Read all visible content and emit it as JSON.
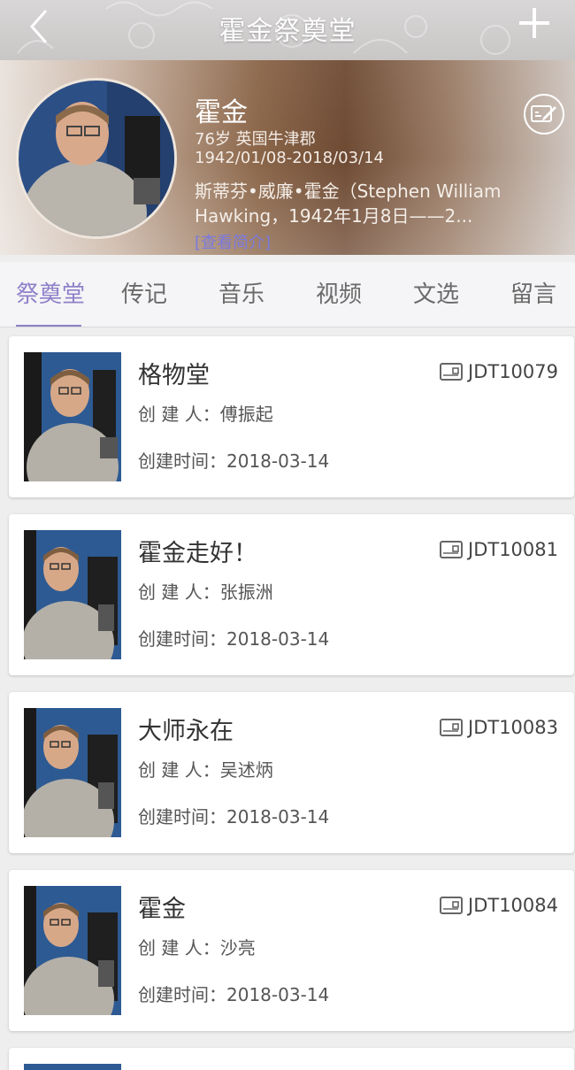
{
  "header": {
    "title": "霍金祭奠堂",
    "back_icon": "chevron-left-icon",
    "add_icon": "plus-icon"
  },
  "profile": {
    "name": "霍金",
    "age_place": "76岁 英国牛津郡",
    "dates": "1942/01/08-2018/03/14",
    "bio_line1": "斯蒂芬•威廉•霍金（Stephen William",
    "bio_line2": "Hawking，1942年1月8日——2...",
    "bio_link": "[查看简介]",
    "edit_icon": "edit-card-icon"
  },
  "tabs": [
    {
      "label": "祭奠堂",
      "active": true
    },
    {
      "label": "传记"
    },
    {
      "label": "音乐"
    },
    {
      "label": "视频"
    },
    {
      "label": "文选"
    },
    {
      "label": "留言"
    }
  ],
  "halls": [
    {
      "title": "格物堂",
      "id": "JDT10079",
      "creator_label": "创 建 人：",
      "creator": "傅振起",
      "date_label": "创建时间：",
      "date": "2018-03-14"
    },
    {
      "title": "霍金走好！",
      "id": "JDT10081",
      "creator_label": "创 建 人：",
      "creator": "张振洲",
      "date_label": "创建时间：",
      "date": "2018-03-14"
    },
    {
      "title": "大师永在",
      "id": "JDT10083",
      "creator_label": "创 建 人：",
      "creator": "吴述炳",
      "date_label": "创建时间：",
      "date": "2018-03-14"
    },
    {
      "title": "霍金",
      "id": "JDT10084",
      "creator_label": "创 建 人：",
      "creator": "沙亮",
      "date_label": "创建时间：",
      "date": "2018-03-14"
    }
  ],
  "colors": {
    "accent": "#8f80c9",
    "link": "#7b79e0"
  }
}
